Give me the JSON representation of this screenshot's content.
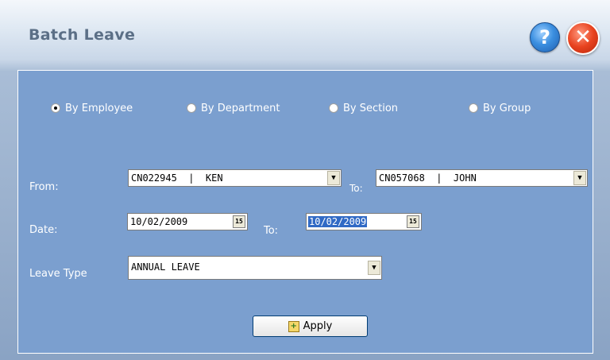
{
  "window": {
    "title": "Batch Leave",
    "help_icon": "?",
    "close_icon": "✕"
  },
  "filter_mode": {
    "options": [
      "By Employee",
      "By Department",
      "By Section",
      "By Group"
    ],
    "selected": "By Employee"
  },
  "employee_range": {
    "from_label": "From:",
    "from_value": "CN022945  |  KEN",
    "to_label": "To:",
    "to_value": "CN057068  |  JOHN",
    "dropdown_glyph": "▼"
  },
  "date_range": {
    "label": "Date:",
    "from_value": "10/02/2009",
    "to_label": "To:",
    "to_value": "10/02/2009",
    "calendar_glyph": "15"
  },
  "leave_type": {
    "label": "Leave Type",
    "value": "ANNUAL LEAVE",
    "dropdown_glyph": "▼"
  },
  "apply_button": {
    "label": "Apply"
  }
}
